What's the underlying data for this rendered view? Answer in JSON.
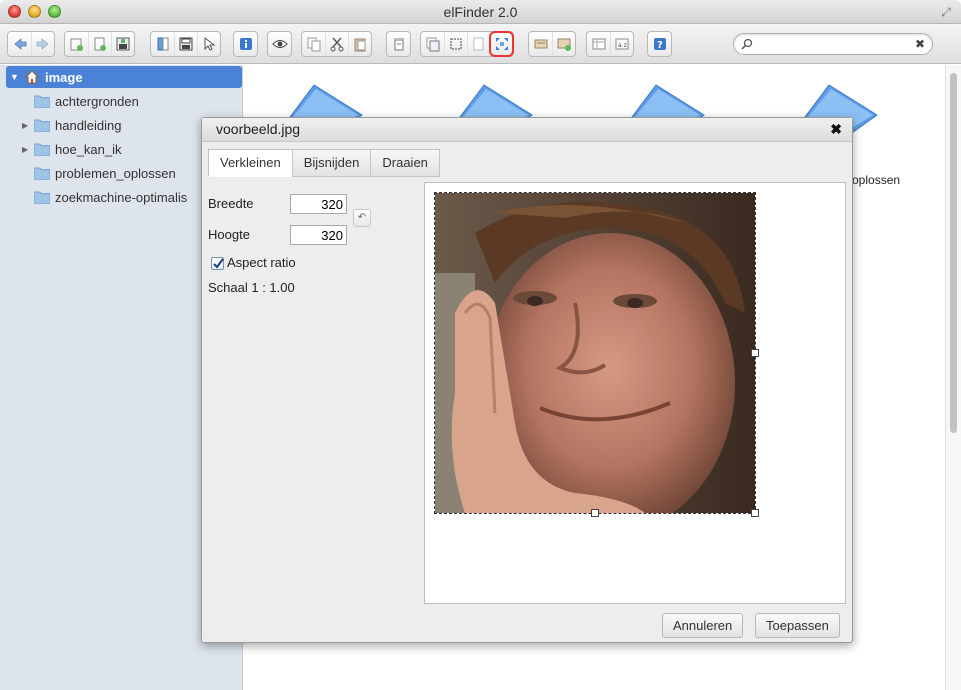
{
  "window": {
    "title": "elFinder 2.0"
  },
  "search": {
    "placeholder": ""
  },
  "sidebar": {
    "root": {
      "label": "image"
    },
    "items": [
      {
        "label": "achtergronden",
        "has_children": false
      },
      {
        "label": "handleiding",
        "has_children": true
      },
      {
        "label": "hoe_kan_ik",
        "has_children": true
      },
      {
        "label": "problemen_oplossen",
        "has_children": false
      },
      {
        "label": "zoekmachine-optimalis",
        "has_children": false
      }
    ]
  },
  "files": {
    "visible_label": "oplossen"
  },
  "toolbar": {
    "icons": [
      "back-icon",
      "forward-icon",
      "new-folder-icon",
      "new-file-icon",
      "upload-icon",
      "open-icon",
      "save-icon",
      "select-icon",
      "info-icon",
      "preview-icon",
      "copy-icon",
      "cut-icon",
      "paste-icon",
      "duplicate-icon",
      "rename-icon",
      "select-area-icon",
      "edit-icon",
      "resize-icon",
      "extract-icon",
      "archive-icon",
      "view-icon",
      "sort-icon",
      "help-icon"
    ],
    "highlighted": "resize-icon"
  },
  "dialog": {
    "title": "voorbeeld.jpg",
    "tabs": [
      "Verkleinen",
      "Bijsnijden",
      "Draaien"
    ],
    "active_tab": "Verkleinen",
    "width_label": "Breedte",
    "width_value": "320",
    "height_label": "Hoogte",
    "height_value": "320",
    "aspect_label": "Aspect ratio",
    "aspect_checked": true,
    "scale_text": "Schaal 1 : 1.00",
    "cancel_label": "Annuleren",
    "apply_label": "Toepassen"
  },
  "colors": {
    "selection": "#4a82d6",
    "sidebar_bg": "#dde4ec",
    "highlight_ring": "#e33333"
  }
}
